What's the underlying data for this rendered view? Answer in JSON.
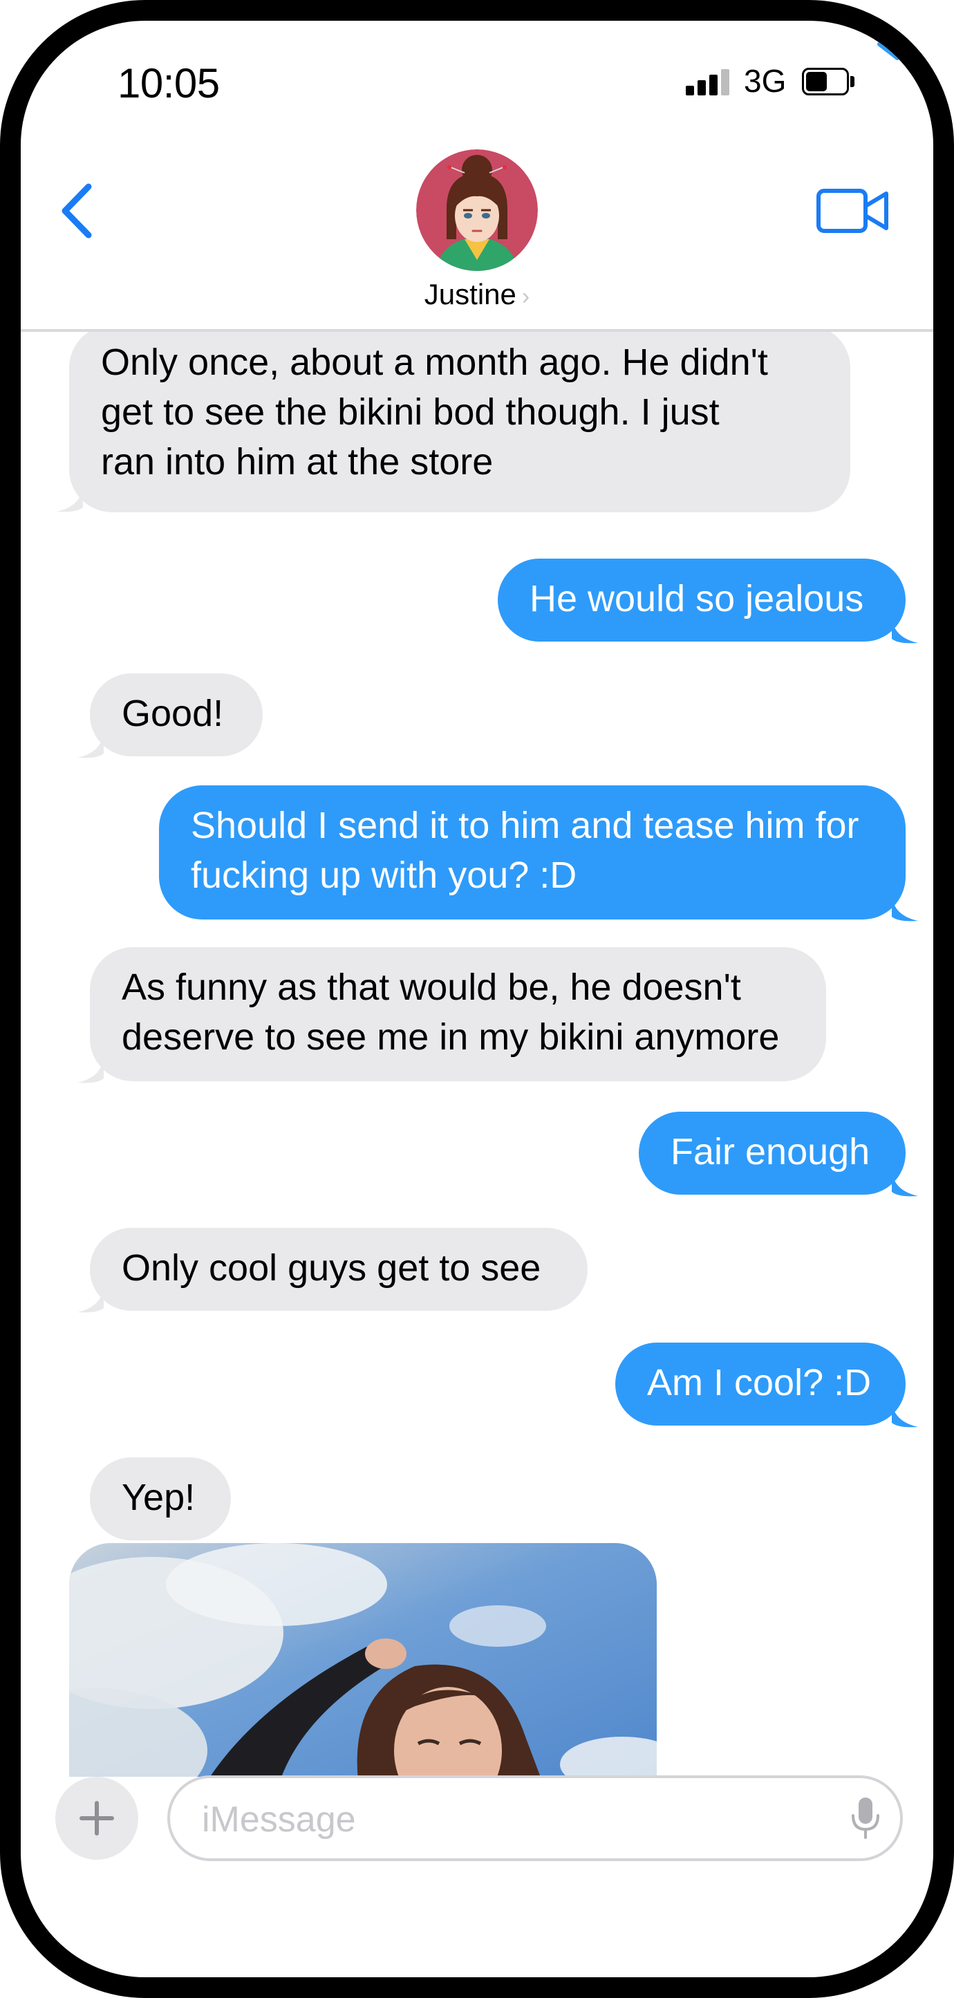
{
  "status_bar": {
    "time": "10:05",
    "network": "3G"
  },
  "header": {
    "contact_name": "Justine",
    "chevron": "›"
  },
  "messages": [
    {
      "from": "contact",
      "text": "Only once, about a month ago.  He didn't\nget to see the bikini bod though.  I just\nran into him at the store"
    },
    {
      "from": "me",
      "text": "He would so jealous"
    },
    {
      "from": "contact",
      "text": "Good!"
    },
    {
      "from": "me",
      "text": "Should I send it to him and tease him for\nfucking up with you? :D"
    },
    {
      "from": "contact",
      "text": "As funny as that would be, he doesn't\ndeserve to see me in my bikini anymore"
    },
    {
      "from": "me",
      "text": "Fair enough"
    },
    {
      "from": "contact",
      "text": "Only cool guys get to see"
    },
    {
      "from": "me",
      "text": "Am I cool? :D"
    },
    {
      "from": "contact",
      "text": "Yep!"
    }
  ],
  "composer": {
    "placeholder": "iMessage"
  },
  "colors": {
    "outgoing_bubble": "#2e9bfa",
    "incoming_bubble": "#e9e9eb",
    "accent": "#1a7cf5"
  },
  "icons": {
    "back": "chevron-left-icon",
    "video": "video-camera-icon",
    "add": "plus-icon",
    "mic": "microphone-icon"
  }
}
